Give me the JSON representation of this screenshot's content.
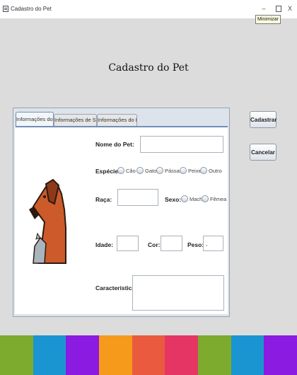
{
  "window": {
    "title": "Cadastro do Pet",
    "minimize_symbol": "–",
    "close_symbol": "X",
    "tooltip": "Minimizar"
  },
  "page_title": "Cadastro do Pet",
  "tabs": [
    {
      "label": "Informações do Pet",
      "active": true
    },
    {
      "label": "Informações de Saúde",
      "active": false
    },
    {
      "label": "Informações do Dono",
      "active": false
    }
  ],
  "form": {
    "nome_label": "Nome do Pet:",
    "nome_value": "",
    "especie_label": "Espécie:",
    "especie_options": [
      "Cão",
      "Gato",
      "Pássaro",
      "Peixe",
      "Outro"
    ],
    "raca_label": "Raça:",
    "raca_value": "",
    "sexo_label": "Sexo:",
    "sexo_options": [
      "Macho",
      "Fêmea"
    ],
    "idade_label": "Idade:",
    "idade_value": "",
    "cor_label": "Cor:",
    "cor_value": "",
    "peso_label": "Peso:",
    "peso_value": ",",
    "caracteristicas_label": "Características:",
    "caracteristicas_value": ""
  },
  "buttons": {
    "cadastrar": "Cadastrar",
    "cancelar": "Cancelar"
  },
  "footer_colors": [
    "#7cab2e",
    "#1b95d2",
    "#8b1be0",
    "#f69a1c",
    "#ea5a3e",
    "#e53565",
    "#7cab2e",
    "#1b95d2",
    "#8b1be0"
  ]
}
